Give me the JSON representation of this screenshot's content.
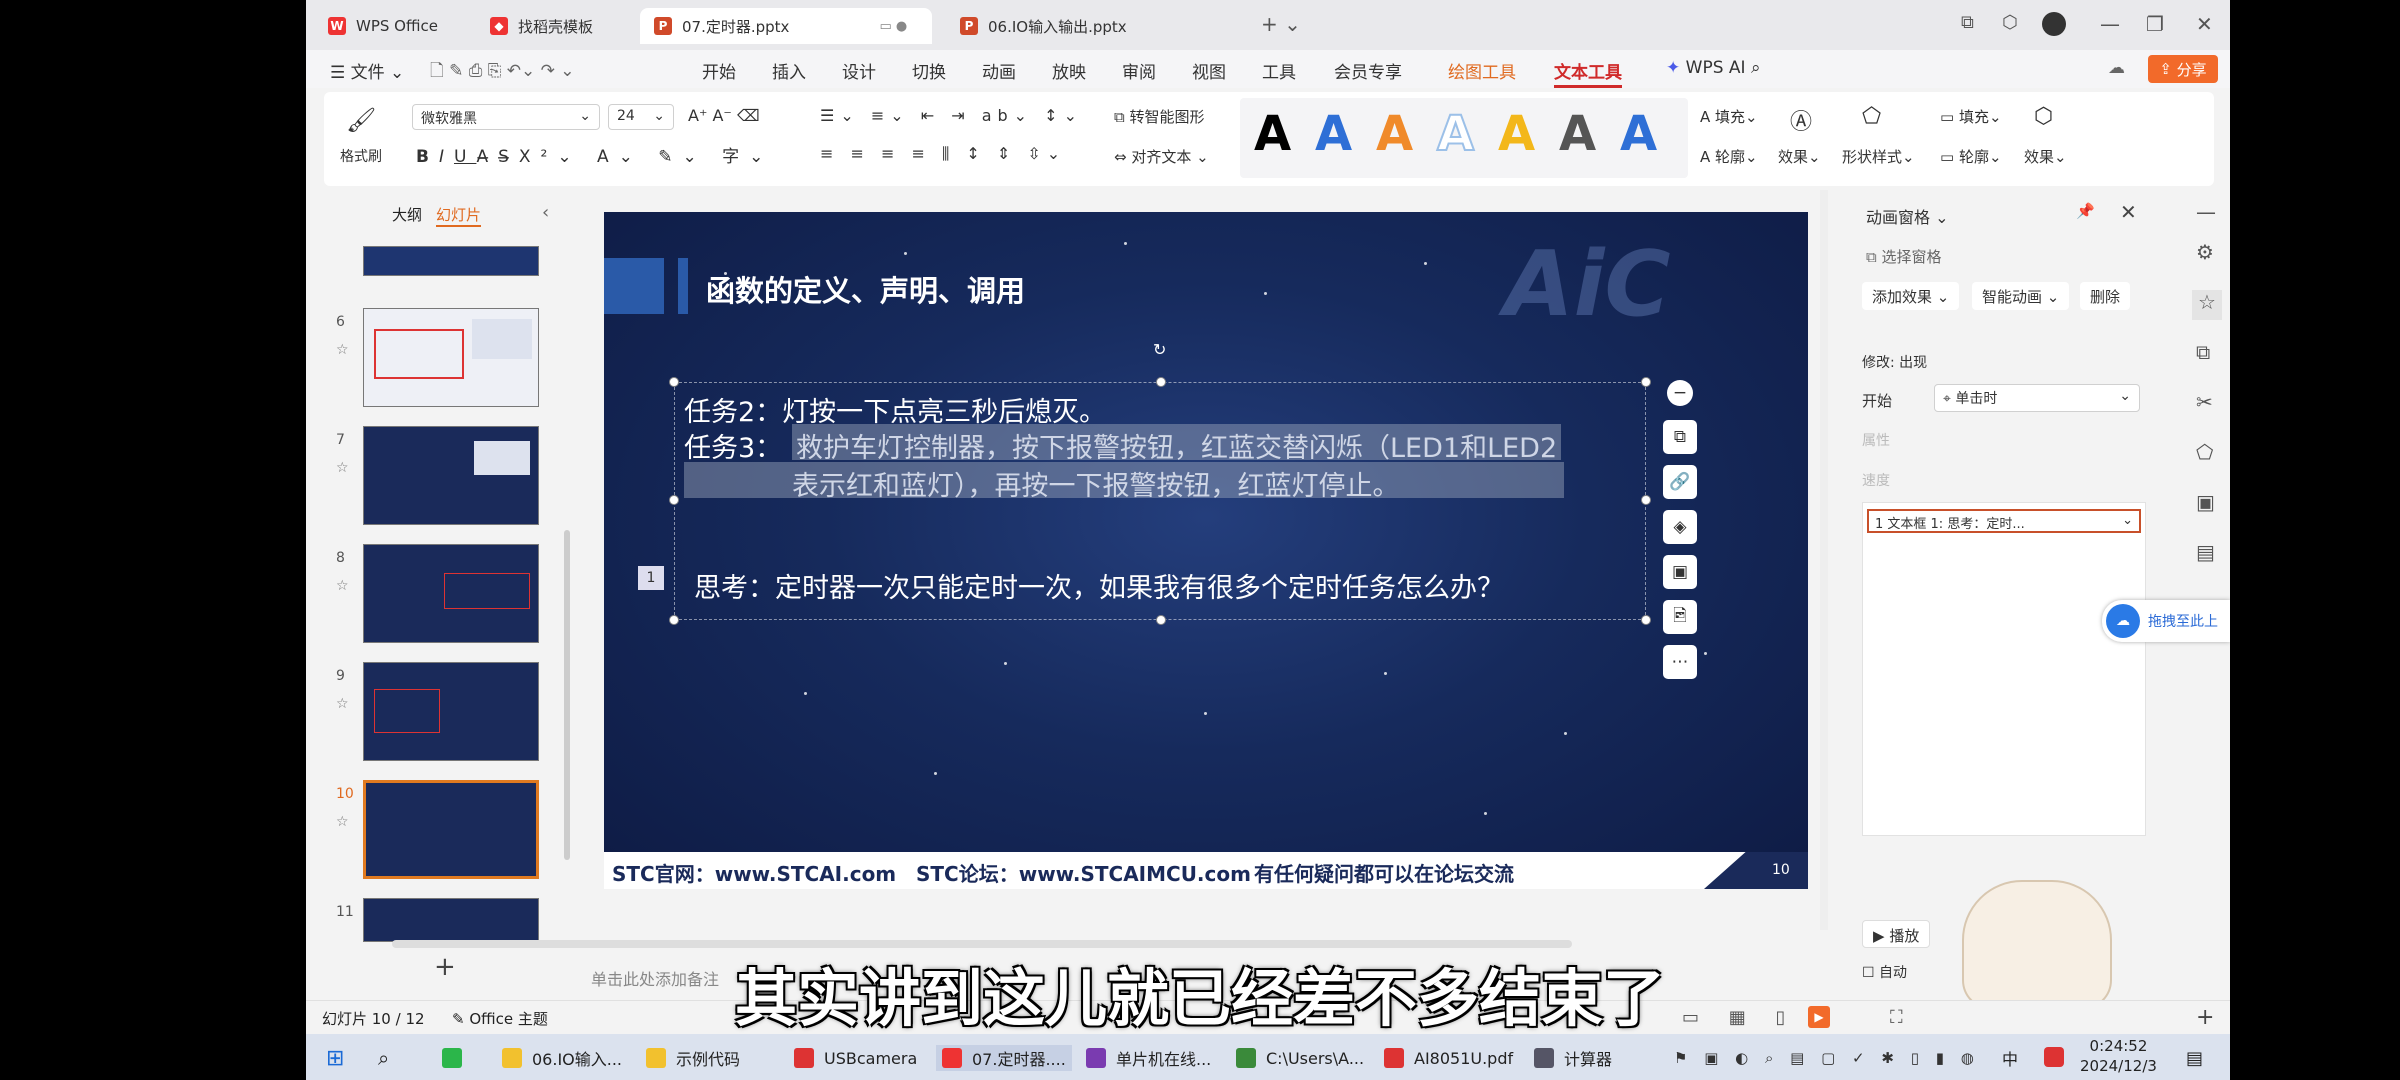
{
  "tabs": [
    {
      "label": "WPS Office",
      "color": "#e33"
    },
    {
      "label": "找稻壳模板",
      "color": "#e33"
    },
    {
      "label": "07.定时器.pptx",
      "color": "#d04a2a"
    },
    {
      "label": "06.IO输入输出.pptx",
      "color": "#d04a2a"
    }
  ],
  "menu": {
    "file": "文件",
    "items": [
      "开始",
      "插入",
      "设计",
      "切换",
      "动画",
      "放映",
      "审阅",
      "视图",
      "工具",
      "会员专享"
    ],
    "drawing_tools": "绘图工具",
    "text_tools": "文本工具",
    "wps_ai": "WPS AI",
    "share": "分享"
  },
  "ribbon": {
    "format_painter": "格式刷",
    "font": "微软雅黑",
    "size": "24",
    "smart_shape": "转智能图形",
    "align_text": "对齐文本",
    "fill": "填充",
    "outline": "轮廓",
    "effect": "效果",
    "shape_style": "形状样式",
    "text_style_colors": [
      "#000000",
      "#2e6fd6",
      "#f08a2a",
      "#9cc0e8",
      "#f3b71a",
      "#555555",
      "#2e6fd6"
    ],
    "text_style_glyph": "A"
  },
  "left_panel": {
    "outline": "大纲",
    "slides": "幻灯片",
    "slide_numbers": [
      "6",
      "7",
      "8",
      "9",
      "10",
      "11"
    ],
    "add": "+"
  },
  "slide": {
    "title": "函数的定义、声明、调用",
    "watermark": "AiC",
    "task2": "任务2：灯按一下点亮三秒后熄灭。",
    "task3_label": "任务3：",
    "task3_line1": "救护车灯控制器，按下报警按钮，红蓝交替闪烁（LED1和LED2",
    "task3_line2": "表示红和蓝灯），再按一下报警按钮，红蓝灯停止。",
    "anim_num": "1",
    "think": "思考：定时器一次只能定时一次，如果我有很多个定时任务怎么办？",
    "footer_site": "STC官网：www.STCAI.com",
    "footer_forum": "STC论坛：www.STCAIMCU.com",
    "footer_note": "有任何疑问都可以在论坛交流",
    "page": "10"
  },
  "notes_placeholder": "单击此处添加备注",
  "right_panel": {
    "title": "动画窗格",
    "select_pane": "选择窗格",
    "add_effect": "添加效果",
    "smart_anim": "智能动画",
    "delete": "删除",
    "modify": "修改: 出现",
    "start_label": "开始",
    "start_value": "单击时",
    "property": "属性",
    "speed": "速度",
    "anim_item": "1  文本框 1: 思考：定时...",
    "play": "播放",
    "autoplay": "自动",
    "drag_hint": "拖拽至此上"
  },
  "status": {
    "slide_count": "幻灯片 10 / 12",
    "theme": "Office 主题"
  },
  "taskbar": {
    "items": [
      {
        "label": "06.IO输入...",
        "color": "#f2c12e"
      },
      {
        "label": "示例代码",
        "color": "#f2c12e"
      },
      {
        "label": "USBcamera",
        "color": "#d33"
      },
      {
        "label": "07.定时器....",
        "color": "#e33"
      },
      {
        "label": "单片机在线...",
        "color": "#7a3bb0"
      },
      {
        "label": "C:\\Users\\A...",
        "color": "#3a8a3a"
      },
      {
        "label": "AI8051U.pdf",
        "color": "#d33"
      },
      {
        "label": "计算器",
        "color": "#556"
      }
    ],
    "ime": "中",
    "time": "0:24:52",
    "date": "2024/12/3"
  },
  "subtitle": "其实讲到这儿就已经差不多结束了"
}
